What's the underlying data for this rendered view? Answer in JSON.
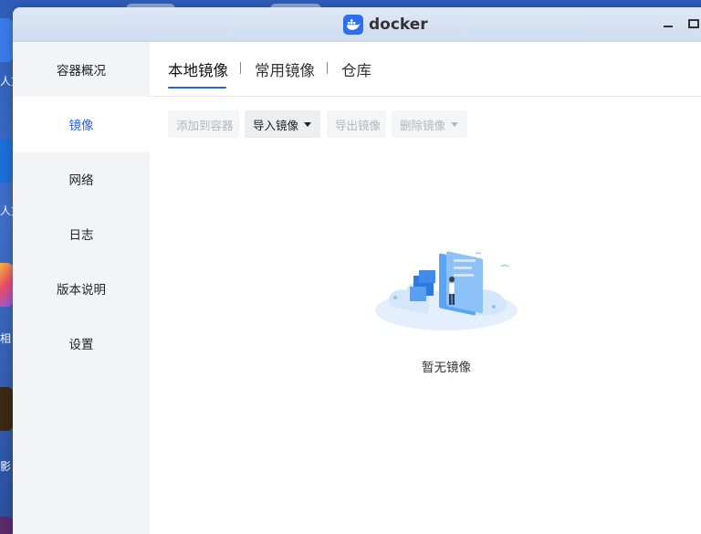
{
  "window": {
    "title": "docker"
  },
  "desktop": {
    "labels": [
      "人文",
      "人文",
      "相",
      "影"
    ]
  },
  "sidebar": {
    "items": [
      {
        "label": "容器概况",
        "active": false
      },
      {
        "label": "镜像",
        "active": true
      },
      {
        "label": "网络",
        "active": false
      },
      {
        "label": "日志",
        "active": false
      },
      {
        "label": "版本说明",
        "active": false
      },
      {
        "label": "设置",
        "active": false
      }
    ]
  },
  "tabs": [
    {
      "label": "本地镜像",
      "active": true
    },
    {
      "label": "常用镜像",
      "active": false
    },
    {
      "label": "仓库",
      "active": false
    }
  ],
  "toolbar": {
    "add_to_container": "添加到容器",
    "import_image": "导入镜像",
    "export_image": "导出镜像",
    "delete_image": "删除镜像"
  },
  "empty_state": {
    "text": "暂无镜像"
  },
  "colors": {
    "accent": "#2e62d8",
    "docker_blue": "#2b6ff0"
  }
}
